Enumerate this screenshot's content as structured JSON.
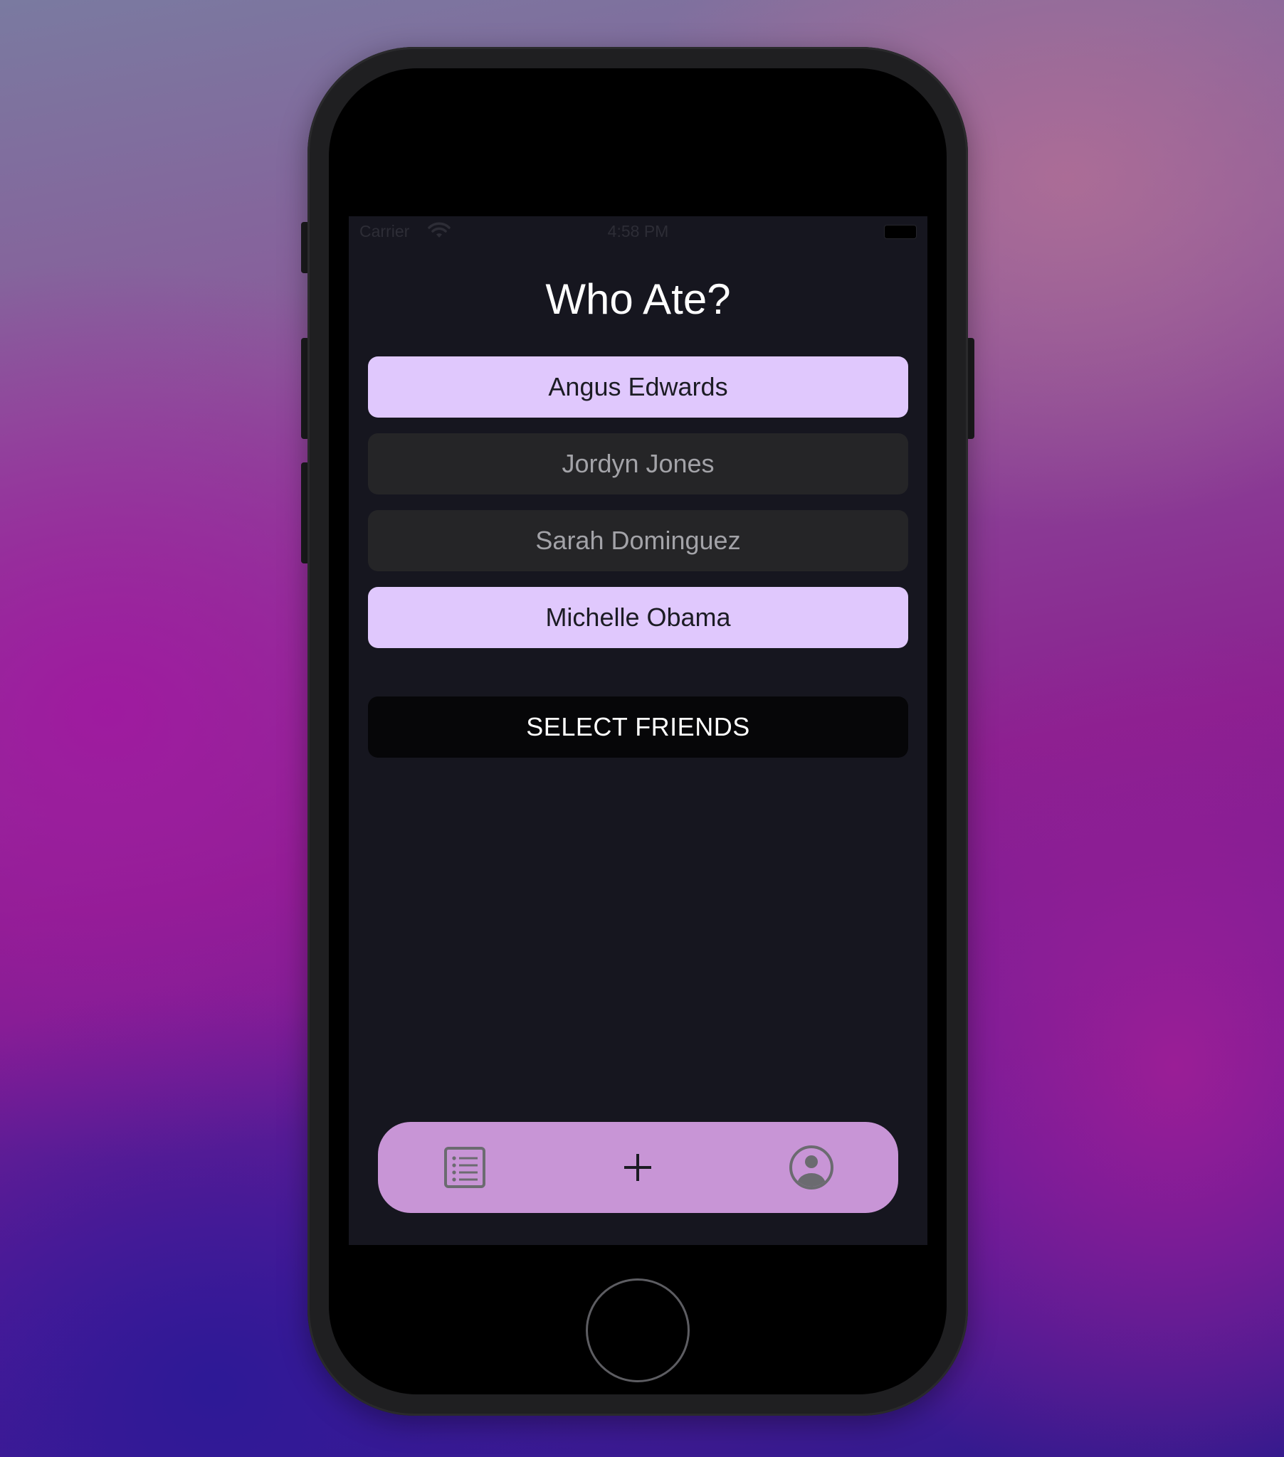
{
  "status_bar": {
    "carrier": "Carrier",
    "time": "4:58 PM",
    "wifi_icon": "wifi-icon",
    "battery_icon": "battery-icon"
  },
  "page": {
    "title": "Who Ate?"
  },
  "friends": [
    {
      "name": "Angus Edwards",
      "selected": true
    },
    {
      "name": "Jordyn Jones",
      "selected": false
    },
    {
      "name": "Sarah Dominguez",
      "selected": false
    },
    {
      "name": "Michelle Obama",
      "selected": true
    }
  ],
  "actions": {
    "select_friends_label": "SELECT FRIENDS"
  },
  "tab_bar": {
    "tabs": [
      {
        "icon": "list-icon"
      },
      {
        "icon": "plus-icon"
      },
      {
        "icon": "profile-icon"
      }
    ]
  },
  "colors": {
    "screen_background": "#16161f",
    "selected_fill": "#e0c8fd",
    "unselected_fill": "#252527",
    "select_button_fill": "#060608",
    "tab_bar_fill": "#c895d6"
  }
}
